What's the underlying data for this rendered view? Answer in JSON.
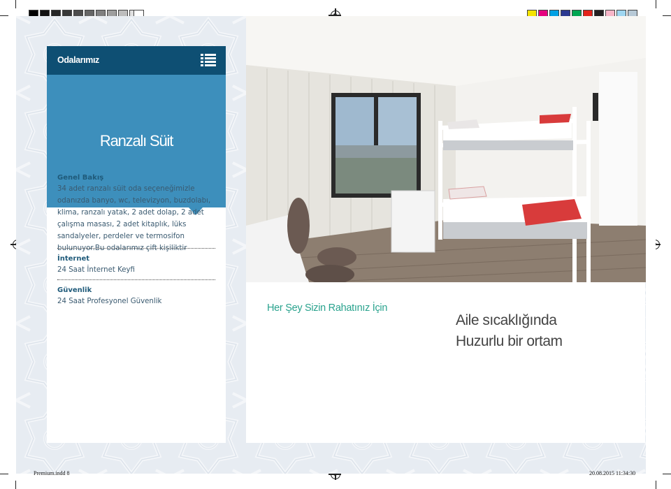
{
  "header": {
    "title": "Odalarımız",
    "menu_icon": "list-icon"
  },
  "room": {
    "name": "Ranzalı Süit"
  },
  "sections": [
    {
      "title": "Genel Bakış",
      "text": "34 adet ranzalı süit oda seçeneğimizle odanızda banyo, wc, televizyon, buzdolabı, klima, ranzalı yatak, 2 adet dolap, 2 adet çalışma masası, 2 adet kitaplık, lüks sandalyeler, perdeler ve termosifon bulunuyor.Bu odalarımız çift kişiliktir"
    },
    {
      "title": "İnternet",
      "text": "24 Saat İnternet Keyfi"
    },
    {
      "title": "Güvenlik",
      "text": "24 Saat Profesyonel Güvenlik"
    }
  ],
  "tagline": "Her Şey Sizin Rahatınız İçin",
  "slogan": {
    "line1": "Aile sıcaklığında",
    "line2": "Huzurlu bir ortam"
  },
  "print_slug": {
    "file": "Premium.indd   8",
    "datetime": "20.08.2015   11:34:30"
  },
  "colors": {
    "header_bg": "#0e4f73",
    "hero_bg": "#3d8fbc",
    "tagline": "#2aa38e",
    "page_bg": "#e7ecf2"
  }
}
